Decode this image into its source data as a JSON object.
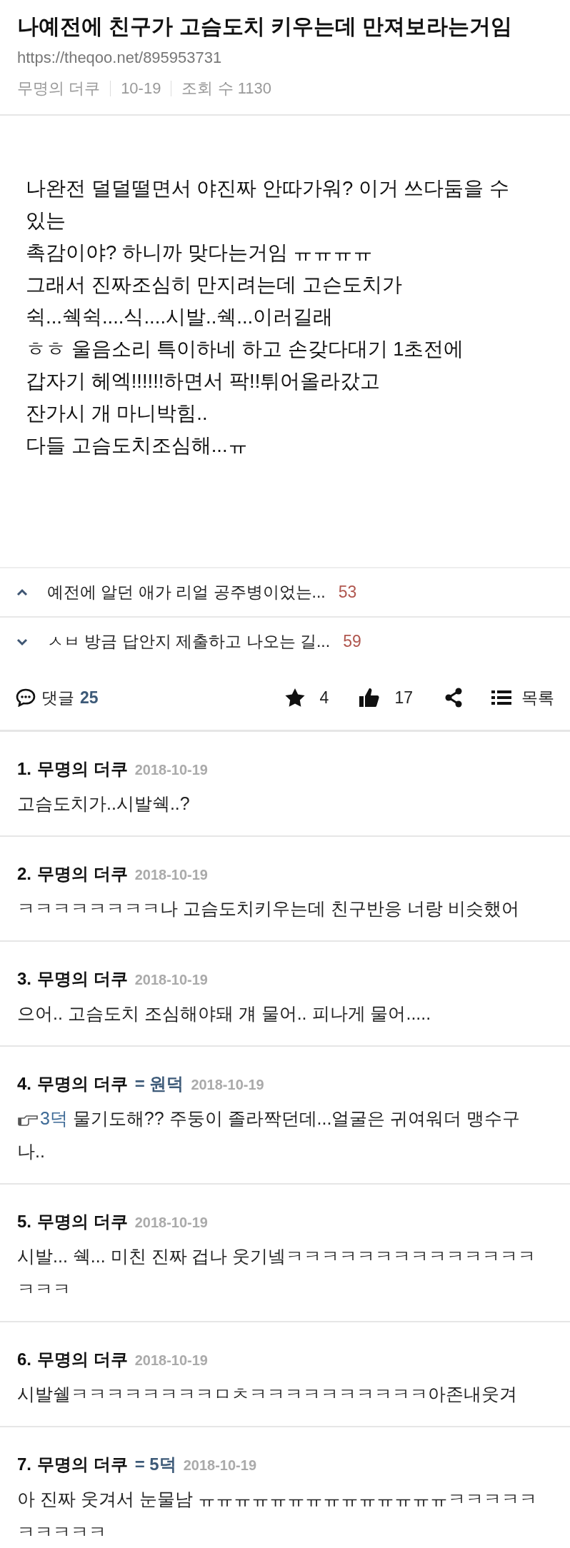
{
  "post": {
    "title": "나예전에 친구가 고슴도치 키우는데 만져보라는거임",
    "url": "https://theqoo.net/895953731",
    "meta": [
      "무명의 더쿠",
      "10-19",
      "조회 수 1130"
    ],
    "body": "나완전 덜덜떨면서 야진짜 안따가워? 이거 쓰다둠을 수 있는\n촉감이야? 하니까 맞다는거임 ㅠㅠㅠㅠ\n그래서 진짜조심히 만지려는데 고슨도치가\n쉭...쉑쉭....식....시발..쉑...이러길래\nㅎㅎ 울음소리 특이하네 하고 손갖다대기 1초전에\n갑자기 헤엑!!!!!!하면서 팍!!튀어올라갔고\n잔가시 개 마니박힘..\n다들 고슴도치조심해...ㅠ"
  },
  "nav": [
    {
      "kind": "previous",
      "title": "예전에 알던 애가 리얼 공주병이었는...",
      "count": "53"
    },
    {
      "kind": "next",
      "title": "ㅅㅂ 방금 답안지 제출하고 나오는 길...",
      "count": "59"
    }
  ],
  "actions": {
    "comments_label": "댓글",
    "comments_count": "25",
    "stars": "4",
    "likes": "17",
    "list_label": "목록"
  },
  "comments": [
    {
      "number": "1.",
      "author": "무명의 더쿠",
      "date": "2018-10-19",
      "text": "고슴도치가..시발쉑..?"
    },
    {
      "number": "2.",
      "author": "무명의 더쿠",
      "date": "2018-10-19",
      "text": "ㅋㅋㅋㅋㅋㅋㅋㅋ나 고슴도치키우는데 친구반응 너랑 비슷했어"
    },
    {
      "number": "3.",
      "author": "무명의 더쿠",
      "date": "2018-10-19",
      "text": "으어.. 고슴도치 조심해야돼 걔 물어.. 피나게 물어....."
    },
    {
      "number": "4.",
      "author": "무명의 더쿠",
      "tag": "= 원덕",
      "date": "2018-10-19",
      "reply_to": "3덕",
      "text": " 물기도해?? 주둥이 졸라짝던데...얼굴은 귀여워더 맹수구나.."
    },
    {
      "number": "5.",
      "author": "무명의 더쿠",
      "date": "2018-10-19",
      "text": "시발... 쉑... 미친 진짜 겁나 웃기넼ㅋㅋㅋㅋㅋㅋㅋㅋㅋㅋㅋㅋㅋㅋㅋㅋㅋ"
    },
    {
      "number": "6.",
      "author": "무명의 더쿠",
      "date": "2018-10-19",
      "text": "시발쉘ㅋㅋㅋㅋㅋㅋㅋㅋㅁㅊㅋㅋㅋㅋㅋㅋㅋㅋㅋㅋ아존내웃겨"
    },
    {
      "number": "7.",
      "author": "무명의 더쿠",
      "tag": "= 5덕",
      "date": "2018-10-19",
      "text": "아 진짜 웃겨서 눈물남 ㅠㅠㅠㅠㅠㅠㅠㅠㅠㅠㅠㅠㅠㅠㅋㅋㅋㅋㅋㅋㅋㅋㅋㅋ"
    }
  ]
}
